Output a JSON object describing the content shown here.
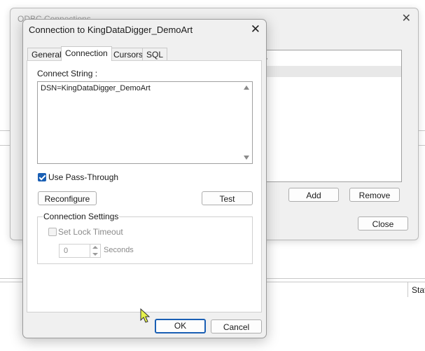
{
  "background": {
    "status_header_fragment": "Stat"
  },
  "odbc_window": {
    "title": "ODBC Connections",
    "list_rows": [
      "r",
      ""
    ],
    "add_label": "Add",
    "remove_label": "Remove",
    "close_label": "Close"
  },
  "dialog": {
    "title": "Connection to KingDataDigger_DemoArt",
    "tabs": [
      {
        "label": "General",
        "active": false
      },
      {
        "label": "Connection",
        "active": true
      },
      {
        "label": "Cursors",
        "active": false
      },
      {
        "label": "SQL",
        "active": false
      }
    ],
    "connect_string_label": "Connect String :",
    "connect_string_value": "DSN=KingDataDigger_DemoArt",
    "use_pass_through_label": "Use Pass-Through",
    "use_pass_through_checked": true,
    "reconfigure_label": "Reconfigure",
    "test_label": "Test",
    "connection_settings_label": "Connection Settings",
    "set_lock_timeout_label": "Set Lock Timeout",
    "set_lock_timeout_checked": false,
    "timeout_value": "0",
    "seconds_label": "Seconds",
    "ok_label": "OK",
    "cancel_label": "Cancel",
    "accent_color": "#1a5fb4"
  }
}
